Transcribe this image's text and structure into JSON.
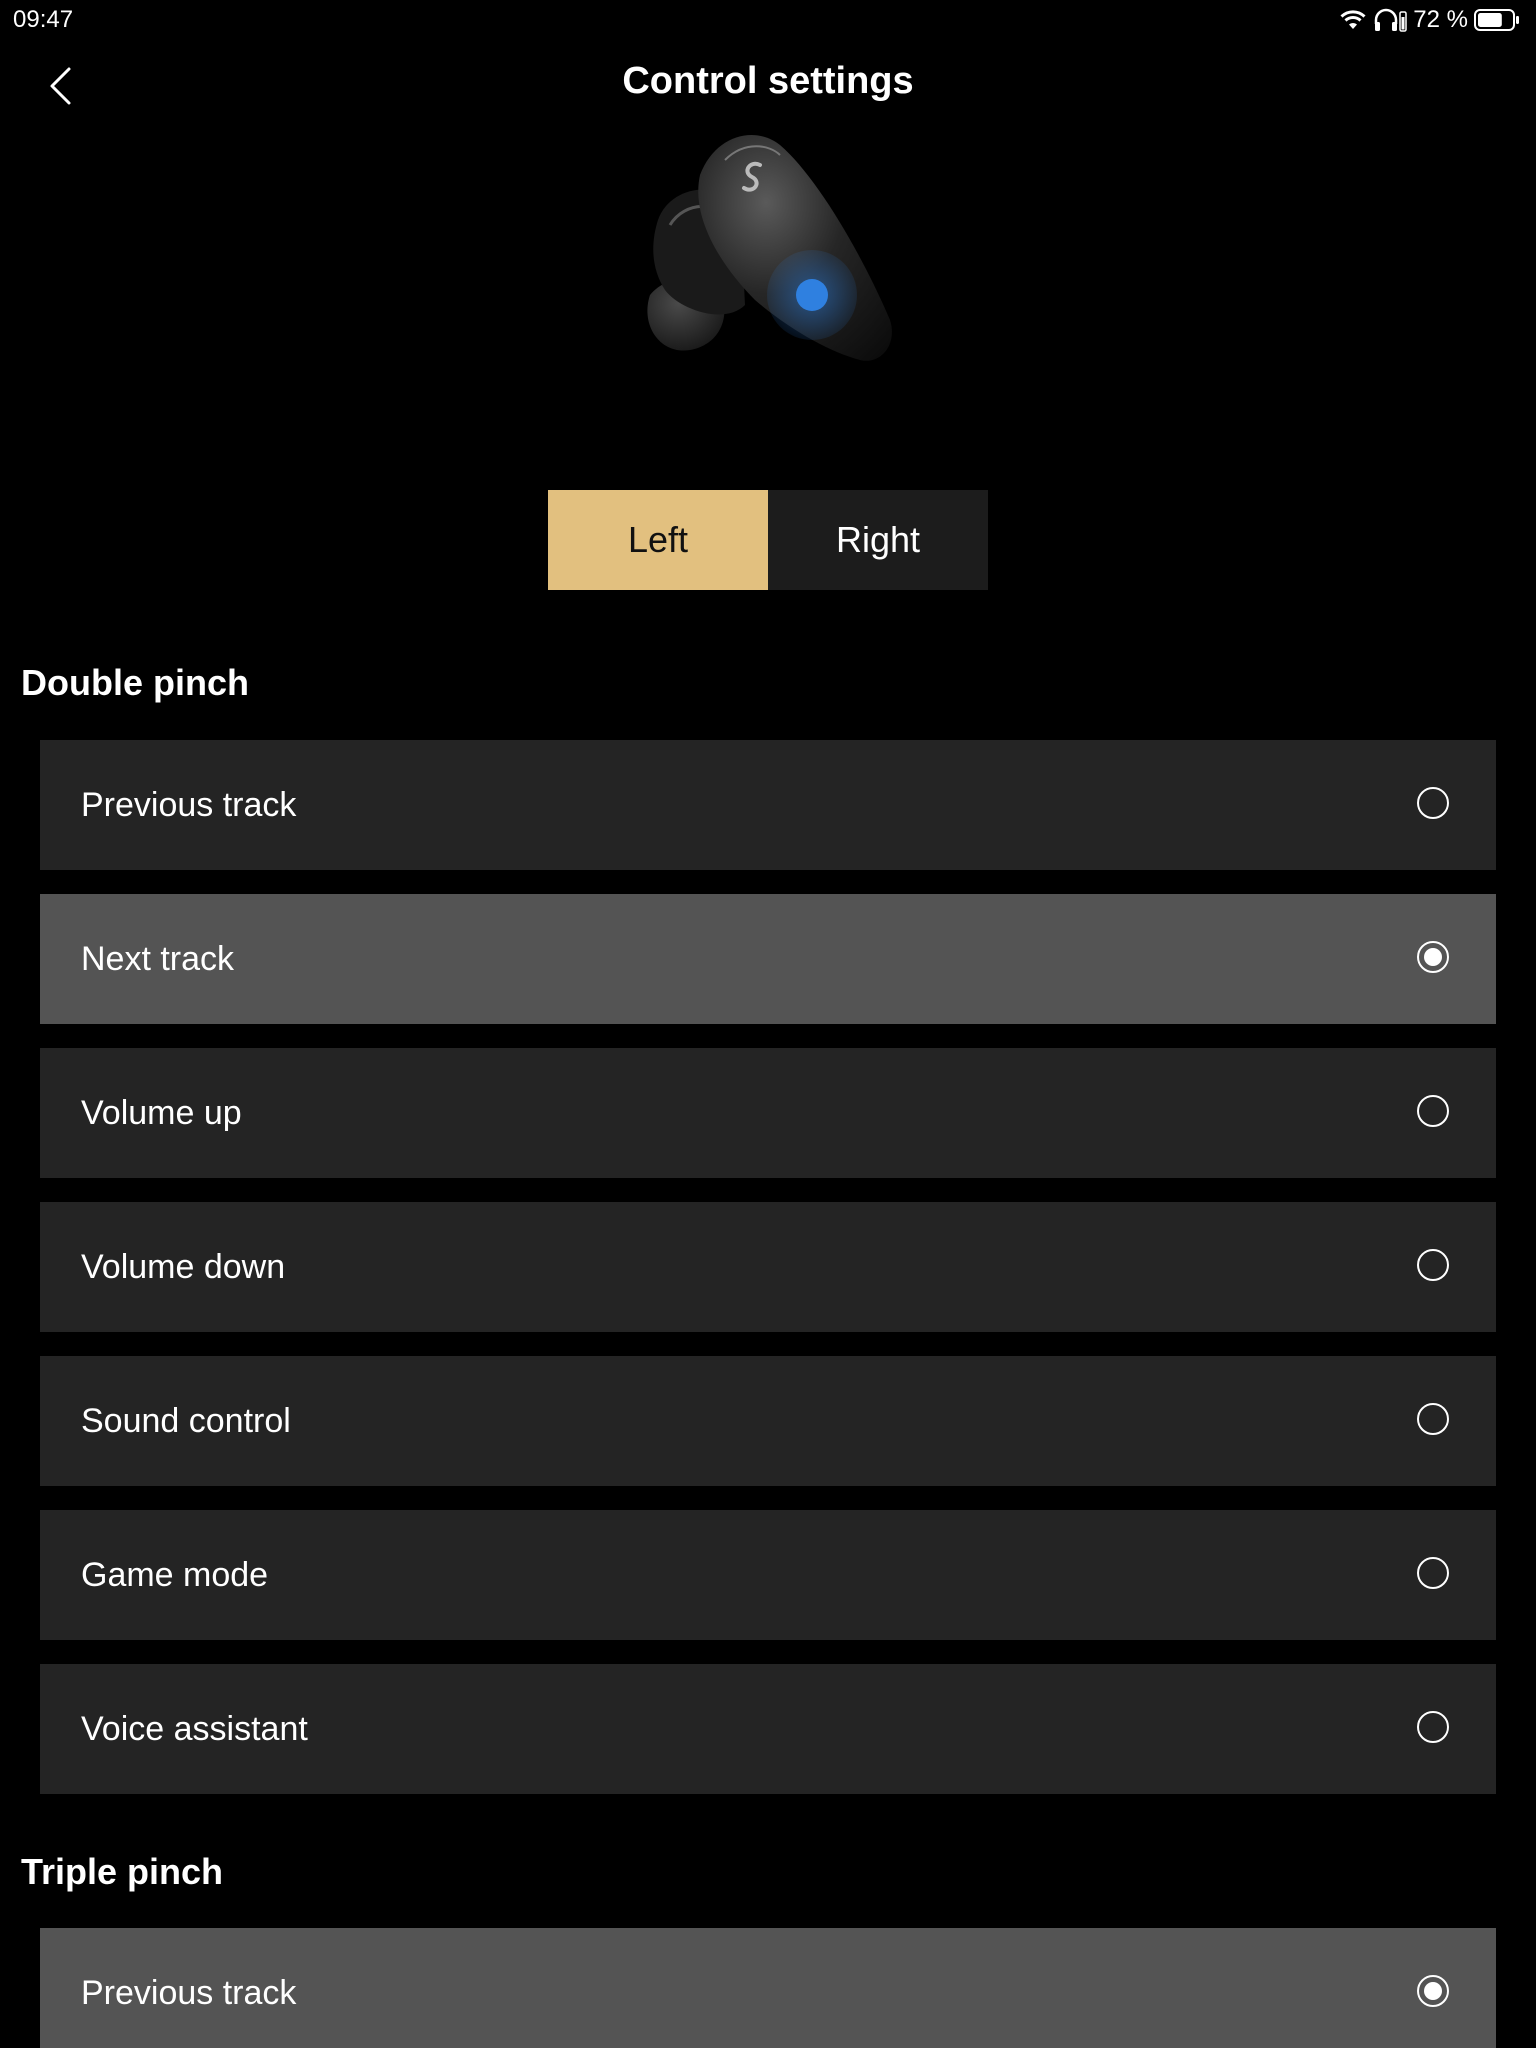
{
  "status_bar": {
    "time": "09:47",
    "battery_percent": "72 %",
    "icons": [
      "wifi-icon",
      "headphones-battery-icon",
      "battery-icon"
    ],
    "battery_level": 0.72
  },
  "header": {
    "title": "Control settings",
    "back_icon": "chevron-left-icon"
  },
  "side_selector": {
    "options": [
      "Left",
      "Right"
    ],
    "selected": "Left",
    "accent_color": "#e2c07f"
  },
  "sections": [
    {
      "heading": "Double pinch",
      "options": [
        {
          "label": "Previous track",
          "selected": false
        },
        {
          "label": "Next track",
          "selected": true
        },
        {
          "label": "Volume up",
          "selected": false
        },
        {
          "label": "Volume down",
          "selected": false
        },
        {
          "label": "Sound control",
          "selected": false
        },
        {
          "label": "Game mode",
          "selected": false
        },
        {
          "label": "Voice assistant",
          "selected": false
        }
      ]
    },
    {
      "heading": "Triple pinch",
      "options": [
        {
          "label": "Previous track",
          "selected": true
        }
      ]
    }
  ],
  "colors": {
    "row_background": "#242424",
    "row_selected_background": "#545454",
    "page_background": "#000000"
  }
}
